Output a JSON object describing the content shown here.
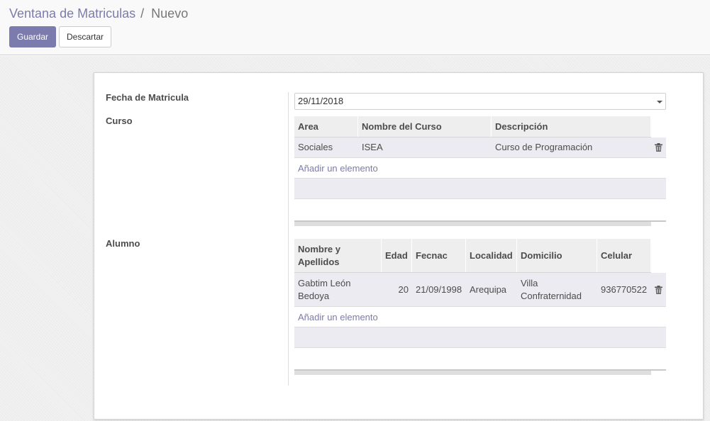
{
  "breadcrumb": {
    "parent": "Ventana de Matriculas",
    "separator": "/",
    "current": "Nuevo"
  },
  "buttons": {
    "save": "Guardar",
    "discard": "Descartar"
  },
  "form": {
    "fecha_label": "Fecha de Matricula",
    "fecha_value": "29/11/2018",
    "curso_label": "Curso",
    "alumno_label": "Alumno"
  },
  "curso_table": {
    "headers": [
      "Area",
      "Nombre del Curso",
      "Descripción"
    ],
    "rows": [
      {
        "area": "Sociales",
        "nombre": "ISEA",
        "descripcion": "Curso de Programación"
      }
    ],
    "add_label": "Añadir un elemento"
  },
  "alumno_table": {
    "headers": [
      "Nombre y Apellidos",
      "Edad",
      "Fecnac",
      "Localidad",
      "Domicilio",
      "Celular"
    ],
    "rows": [
      {
        "nombre": "Gabtim León Bedoya",
        "edad": "20",
        "fecnac": "21/09/1998",
        "localidad": "Arequipa",
        "domicilio": "Villa Confraternidad",
        "celular": "936770522"
      }
    ],
    "add_label": "Añadir un elemento"
  },
  "icons": {
    "delete": "trash-icon",
    "dropdown": "caret-down-icon"
  },
  "colors": {
    "accent": "#7c7bad",
    "row_bg": "#ecebf2",
    "header_bg": "#eeeeee"
  }
}
